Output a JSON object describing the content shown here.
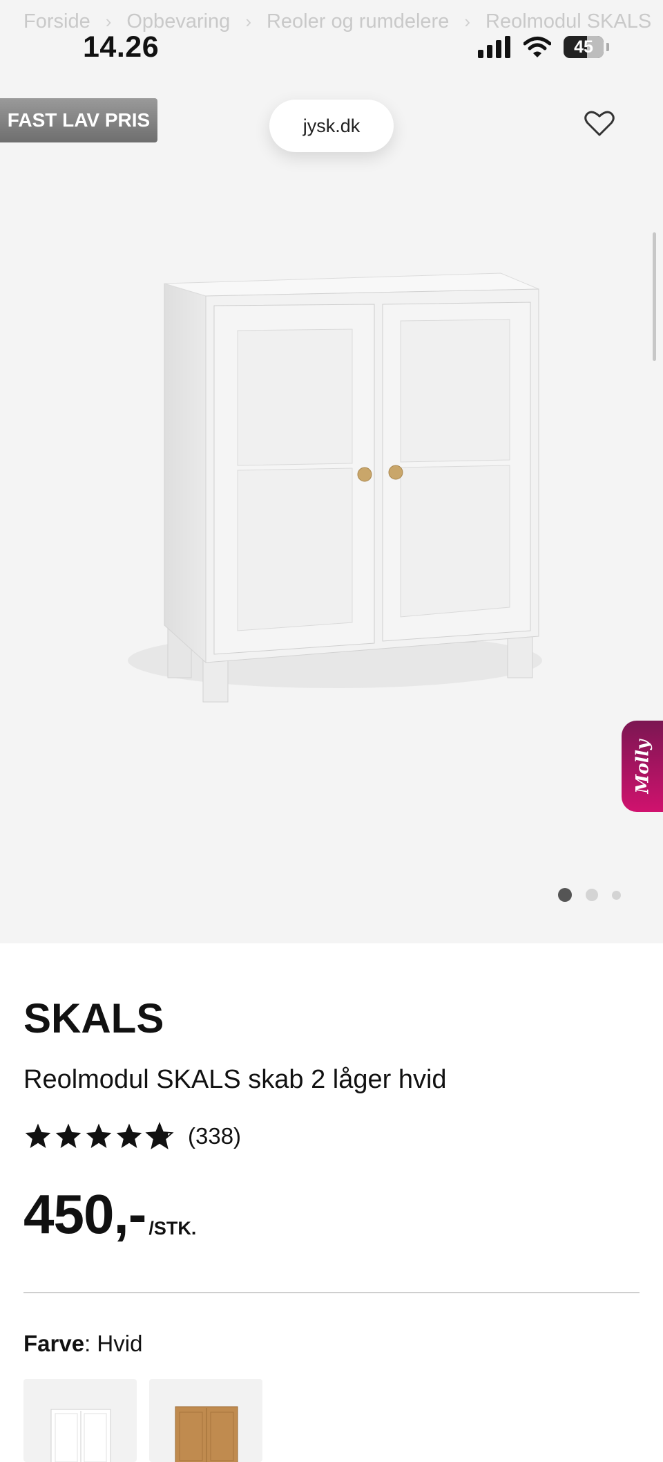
{
  "breadcrumb": {
    "items": [
      "Forside",
      "Opbevaring",
      "Reoler og rumdelere",
      "Reolmodul SKALS"
    ],
    "separator": "›"
  },
  "status_bar": {
    "time": "14.26",
    "battery": "45"
  },
  "hero": {
    "badge": "FAST LAV PRIS",
    "url": "jysk.dk",
    "chat_label": "Molly",
    "carousel": {
      "total": 3,
      "active": 1
    }
  },
  "product": {
    "brand": "SKALS",
    "name": "Reolmodul SKALS skab 2 låger hvid",
    "rating": 4.8,
    "review_count": "(338)",
    "price": "450,-",
    "price_unit": "/STK."
  },
  "color": {
    "label": "Farve",
    "value": ": Hvid"
  },
  "colors": {
    "accent": "#d0126e",
    "badge": "#7d7d7d"
  }
}
